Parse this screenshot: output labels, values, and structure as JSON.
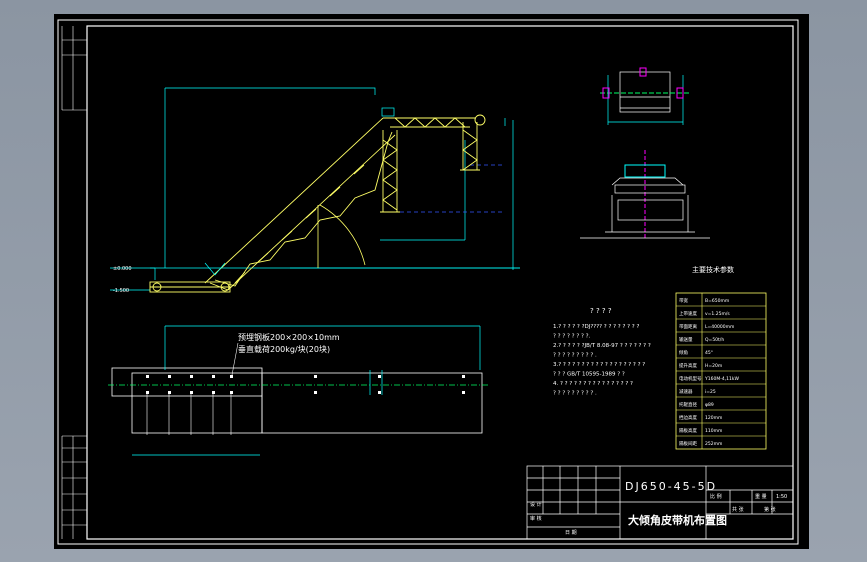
{
  "drawing": {
    "title_code": "DJ650-45-5D",
    "title_name": "大倾角皮带机布置图",
    "scale": "1:50",
    "notes_heading": "? ? ? ?",
    "notes_lines": [
      "1.? ? ? ? ? ?DJ????  ? ? ? ? ? ? ? ?",
      "  ? ? ? ? ? ? ? ?.",
      "2.? ? ? ? ? ?JB/T 8.08-97 ? ? ? ? ? ? ?",
      "  ? ? ? ? ? ? ? ? ? .",
      "3.? ? ? ? ? ? ? ? ? ? ? ? ? ? ? ? ? ? ?",
      "  ? ? ? GB/T 10595-1989 ? ?",
      "4. ? ? ? ? ? ? ? ? ? ? ? ? ? ? ? ?",
      "  ? ? ? ? ? ? ? ? ? ."
    ],
    "annotation_1": "预埋钢板200×200×10mm",
    "annotation_2": "垂直载荷200kg/块(20块)",
    "param_title": "主要技术参数",
    "params": [
      {
        "label": "带宽",
        "value": "B=650mm"
      },
      {
        "label": "上带速度",
        "value": "v=1.25m/s"
      },
      {
        "label": "带面距离",
        "value": "L=40000mm"
      },
      {
        "label": "输送量",
        "value": "Q=50t/h"
      },
      {
        "label": "倾角",
        "value": "45°"
      },
      {
        "label": "提升高度",
        "value": "H=20m"
      },
      {
        "label": "电动机型号",
        "value": "Y160M-4,11kW"
      },
      {
        "label": "减速器",
        "value": "i=25"
      },
      {
        "label": "托辊直径",
        "value": "φ89"
      },
      {
        "label": "挡边高度",
        "value": "120mm"
      },
      {
        "label": "隔板高度",
        "value": "110mm"
      },
      {
        "label": "隔板间距",
        "value": "252mm"
      }
    ],
    "tb_designer": "设 计",
    "tb_checker": "审 核",
    "tb_date": "日 期",
    "tb_scale_label": "比 例",
    "tb_weight_label": "重 量",
    "tb_sheet": "共 张",
    "tb_sheet2": "第 张",
    "dim_label_1": "±0.000",
    "dim_label_2": "-1.500",
    "colors": {
      "background": "#000000",
      "frame": "#ffffff",
      "structure": "#ffff66",
      "cyan": "#00ffff",
      "magenta": "#ff00ff",
      "blue": "#3355ff"
    }
  }
}
